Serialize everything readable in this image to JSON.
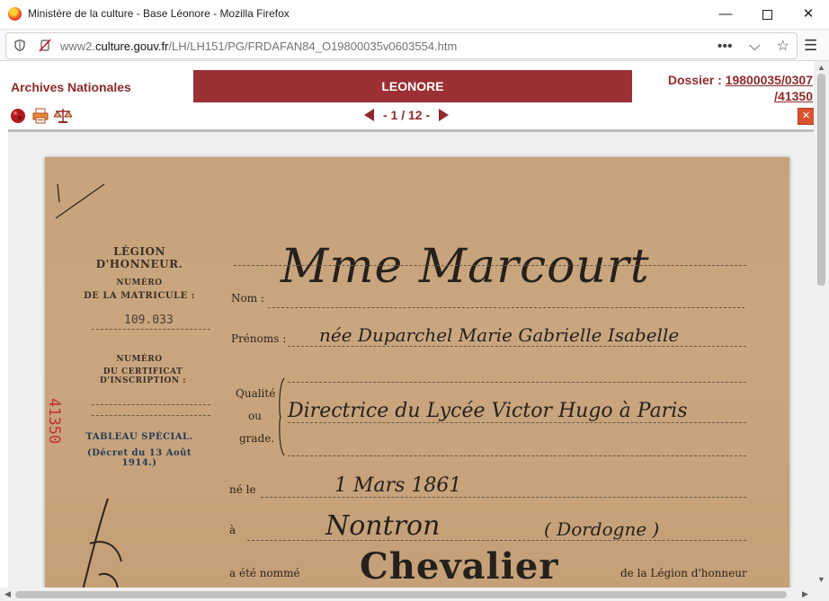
{
  "window": {
    "title": "Ministère de la culture - Base Léonore - Mozilla Firefox"
  },
  "urlbar": {
    "prefix": "www2.",
    "domain": "culture.gouv.fr",
    "path": "/LH/LH151/PG/FRDAFAN84_O19800035v0603554.htm",
    "actions": [
      "more-icon",
      "pocket-icon",
      "bookmark-star-icon"
    ]
  },
  "header": {
    "brand": "Archives Nationales",
    "banner": "LEONORE",
    "dossier_label": "Dossier :",
    "dossier_line1": "19800035/0307",
    "dossier_line2": "/41350"
  },
  "toolbar": {
    "tools": [
      "record-icon",
      "print-icon",
      "scales-icon"
    ],
    "pager": "- 1 / 12 -",
    "close": "×"
  },
  "document": {
    "heading": "LÉGION D'HONNEUR.",
    "matricule_label1": "NUMÉRO",
    "matricule_label2": "DE LA MATRICULE :",
    "matricule_value": "109.033",
    "certificat_label1": "NUMÉRO",
    "certificat_label2": "DU CERTIFICAT D'INSCRIPTION :",
    "special1": "TABLEAU SPÉCIAL.",
    "special2": "(Décret du 13 Août 1914.)",
    "stamp_number": "41350",
    "label_nom": "Nom :",
    "value_nom": "Mme Marcourt",
    "label_prenoms": "Prénoms :",
    "value_prenoms": "née Duparchel Marie Gabrielle Isabelle",
    "label_qualite1": "Qualité",
    "label_qualite2": "ou",
    "label_qualite3": "grade.",
    "value_qualite": "Directrice du Lycée Victor Hugo à Paris",
    "label_ne": "né le",
    "value_ne": "1 Mars 1861",
    "label_a": "à",
    "value_lieu": "Nontron",
    "value_dept": "( Dordogne )",
    "label_nomme": "a été nommé",
    "value_grade": "Chevalier",
    "label_ordre": "de la Légion d'honneur"
  }
}
